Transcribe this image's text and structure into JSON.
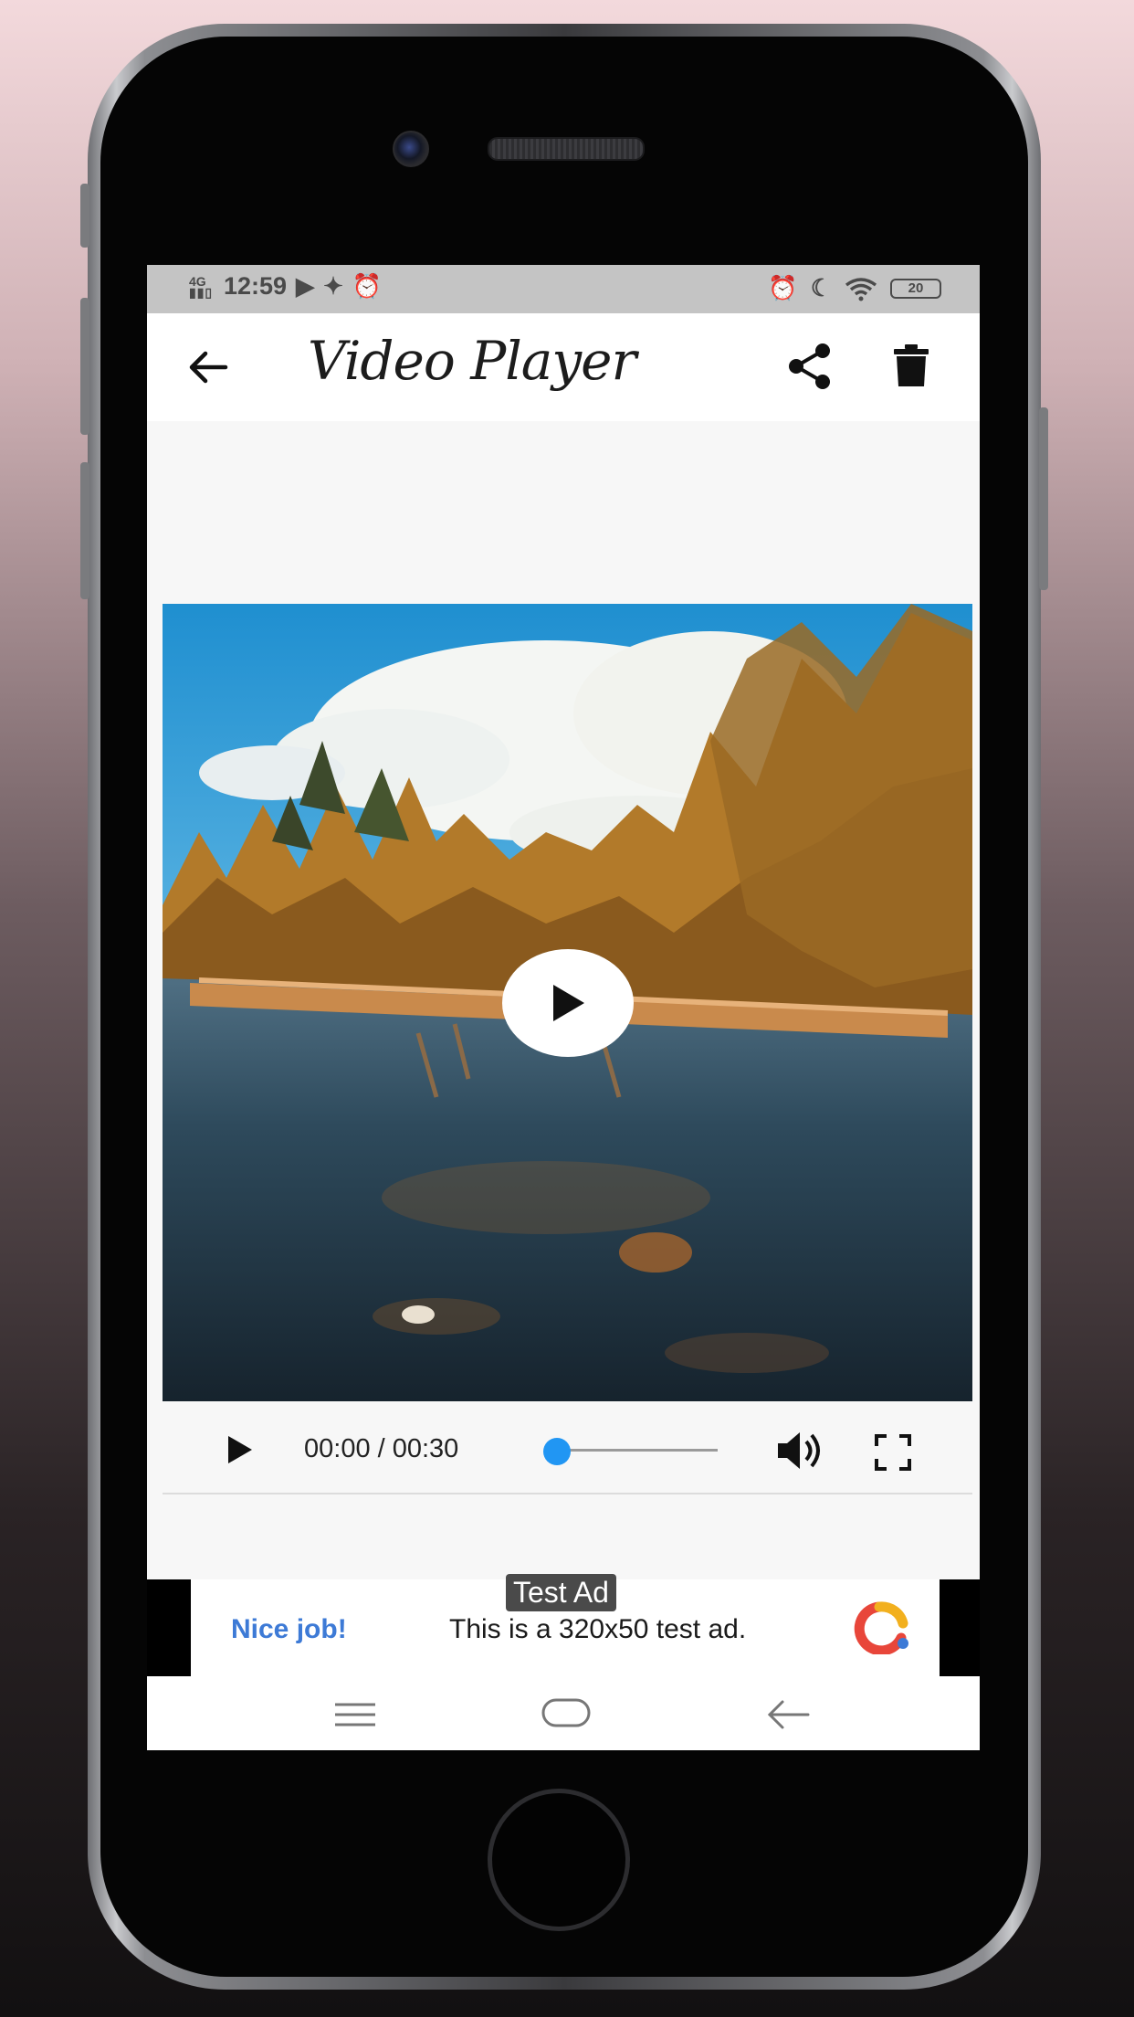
{
  "status_bar": {
    "network": "4G",
    "time": "12:59",
    "battery": "20"
  },
  "app_bar": {
    "title": "Video Player"
  },
  "player": {
    "time_display": "00:00 / 00:30",
    "progress": 0.0
  },
  "ad": {
    "badge": "Test Ad",
    "headline": "Nice job!",
    "body": "This is a 320x50 test ad."
  },
  "colors": {
    "accent": "#2196f3",
    "ad_link": "#3d7ad6"
  }
}
